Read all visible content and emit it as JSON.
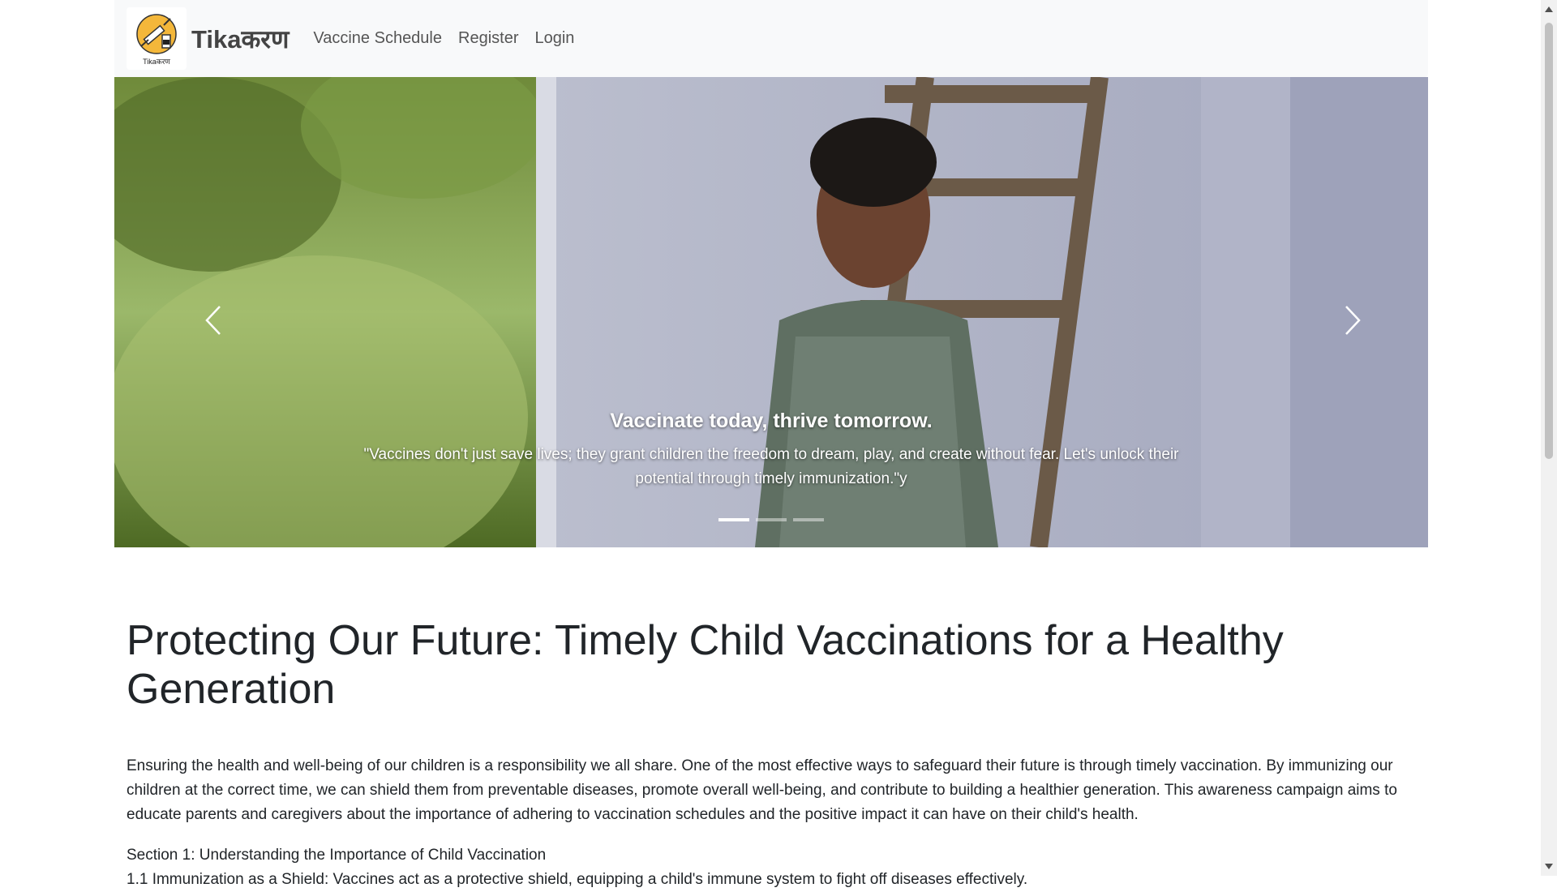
{
  "navbar": {
    "logo_caption": "Tikaकरण",
    "brand": "Tikaकरण",
    "links": [
      {
        "label": "Vaccine Schedule"
      },
      {
        "label": "Register"
      },
      {
        "label": "Login"
      }
    ]
  },
  "carousel": {
    "caption_title": "Vaccinate today, thrive tomorrow.",
    "caption_text": "\"Vaccines don't just save lives; they grant children the freedom to dream, play, and create without fear. Let's unlock their potential through timely immunization.\"y",
    "slide_count": 3,
    "active_slide": 1,
    "prev_icon": "chevron-left-icon",
    "next_icon": "chevron-right-icon"
  },
  "article": {
    "heading": "Protecting Our Future: Timely Child Vaccinations for a Healthy Generation",
    "intro": "Ensuring the health and well-being of our children is a responsibility we all share. One of the most effective ways to safeguard their future is through timely vaccination. By immunizing our children at the correct time, we can shield them from preventable diseases, promote overall well-being, and contribute to building a healthier generation. This awareness campaign aims to educate parents and caregivers about the importance of adhering to vaccination schedules and the positive impact it can have on their child's health.",
    "section_title": "Section 1: Understanding the Importance of Child Vaccination",
    "section_line": "1.1 Immunization as a Shield: Vaccines act as a protective shield, equipping a child's immune system to fight off diseases effectively."
  },
  "colors": {
    "navbar_bg": "#f8f9fa",
    "text": "#212529",
    "nav_link": "#555555",
    "brand": "#444444"
  }
}
